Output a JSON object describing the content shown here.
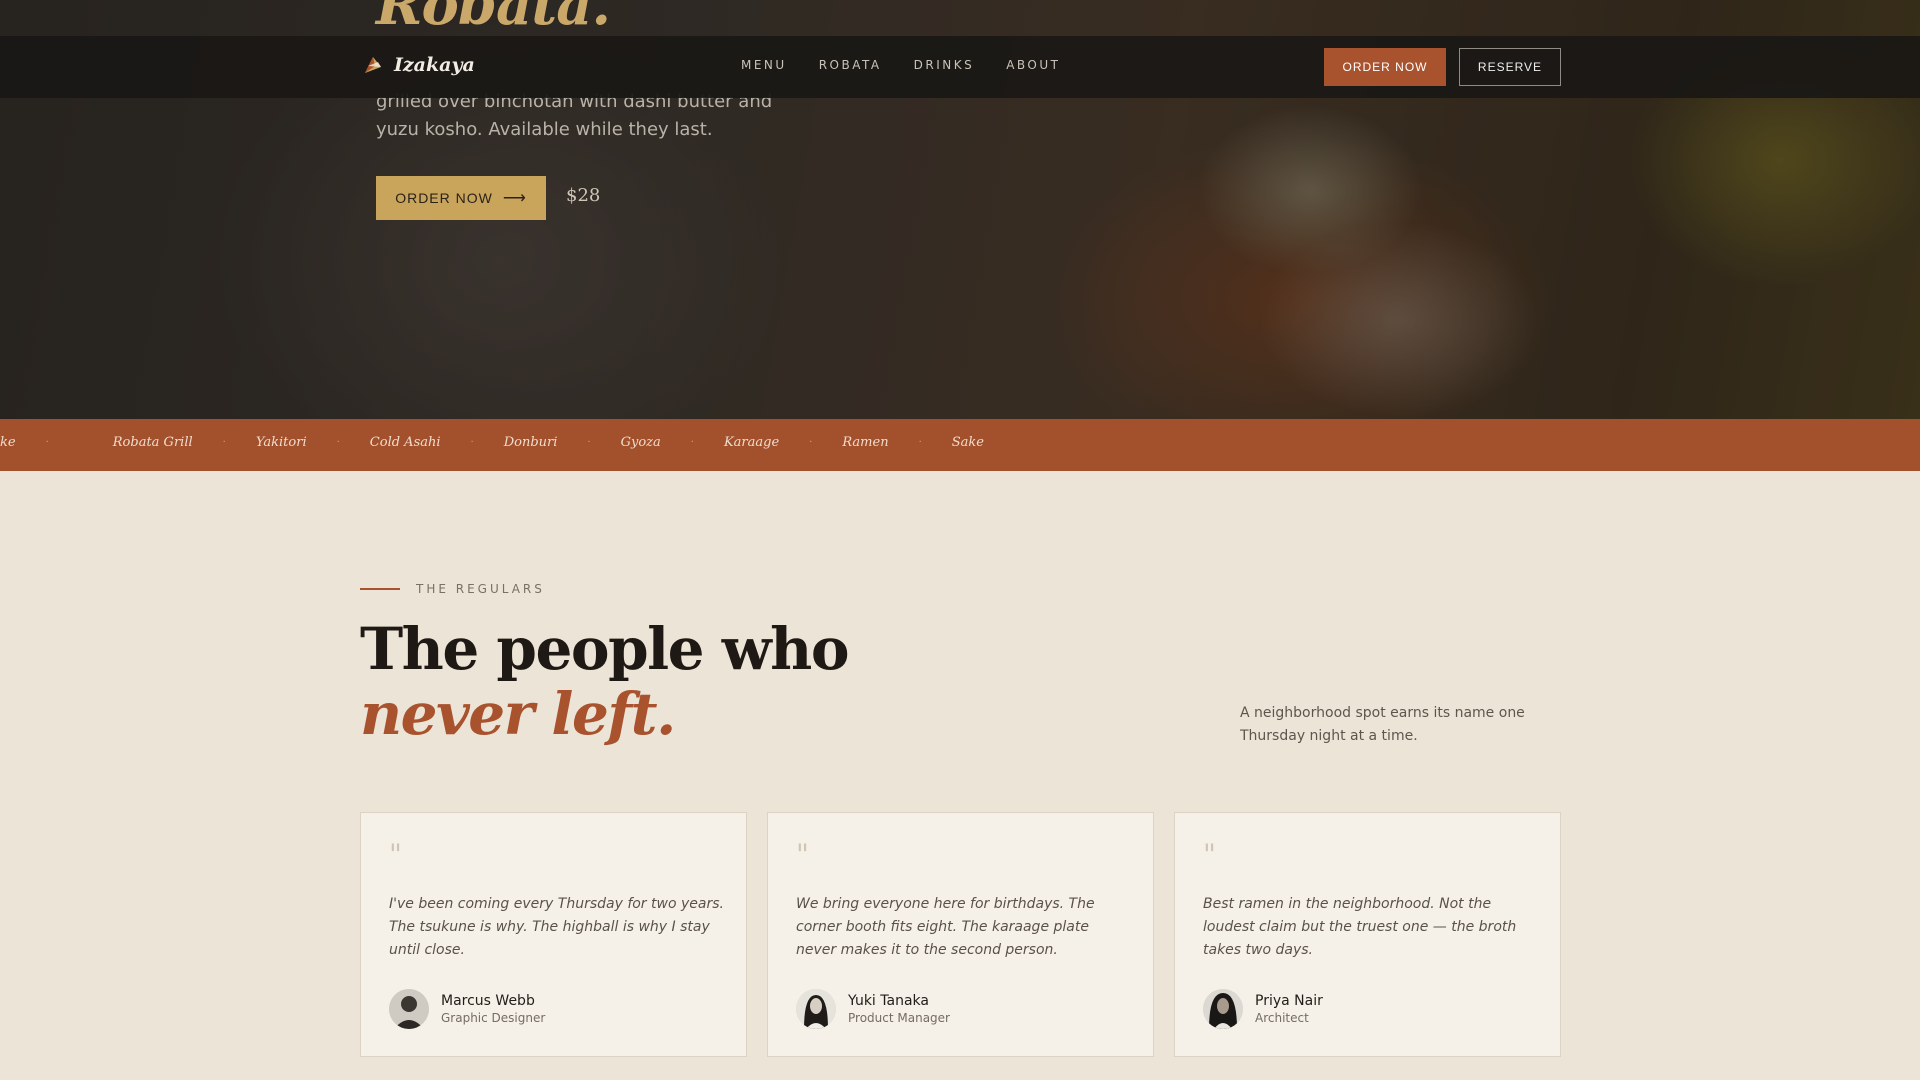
{
  "hero": {
    "title": "Robata.",
    "description": "grilled over binchotan with dashi butter and yuzu kosho. Available while they last.",
    "cta_label": "ORDER NOW",
    "price": "$28"
  },
  "nav": {
    "brand": "Izakaya",
    "links": [
      "MENU",
      "ROBATA",
      "DRINKS",
      "ABOUT"
    ],
    "order_label": "ORDER NOW",
    "reserve_label": "RESERVE"
  },
  "marquee": {
    "items": [
      "ke",
      "Robata Grill",
      "Yakitori",
      "Cold Asahi",
      "Donburi",
      "Gyoza",
      "Karaage",
      "Ramen",
      "Sake"
    ]
  },
  "regulars": {
    "eyebrow": "THE REGULARS",
    "heading_line1": "The people who",
    "heading_line2": "never left.",
    "intro": "A neighborhood spot earns its name one Thursday night at a time.",
    "quote_mark": "\"",
    "testimonials": [
      {
        "quote": "I've been coming every Thursday for two years. The tsukune is why. The highball is why I stay until close.",
        "name": "Marcus Webb",
        "role": "Graphic Designer"
      },
      {
        "quote": "We bring everyone here for birthdays. The corner booth fits eight. The karaage plate never makes it to the second person.",
        "name": "Yuki Tanaka",
        "role": "Product Manager"
      },
      {
        "quote": "Best ramen in the neighborhood. Not the loudest claim but the truest one — the broth takes two days.",
        "name": "Priya Nair",
        "role": "Architect"
      }
    ]
  },
  "colors": {
    "accent": "#a9522e",
    "gold": "#c9a55c",
    "background": "#ece4d6"
  }
}
